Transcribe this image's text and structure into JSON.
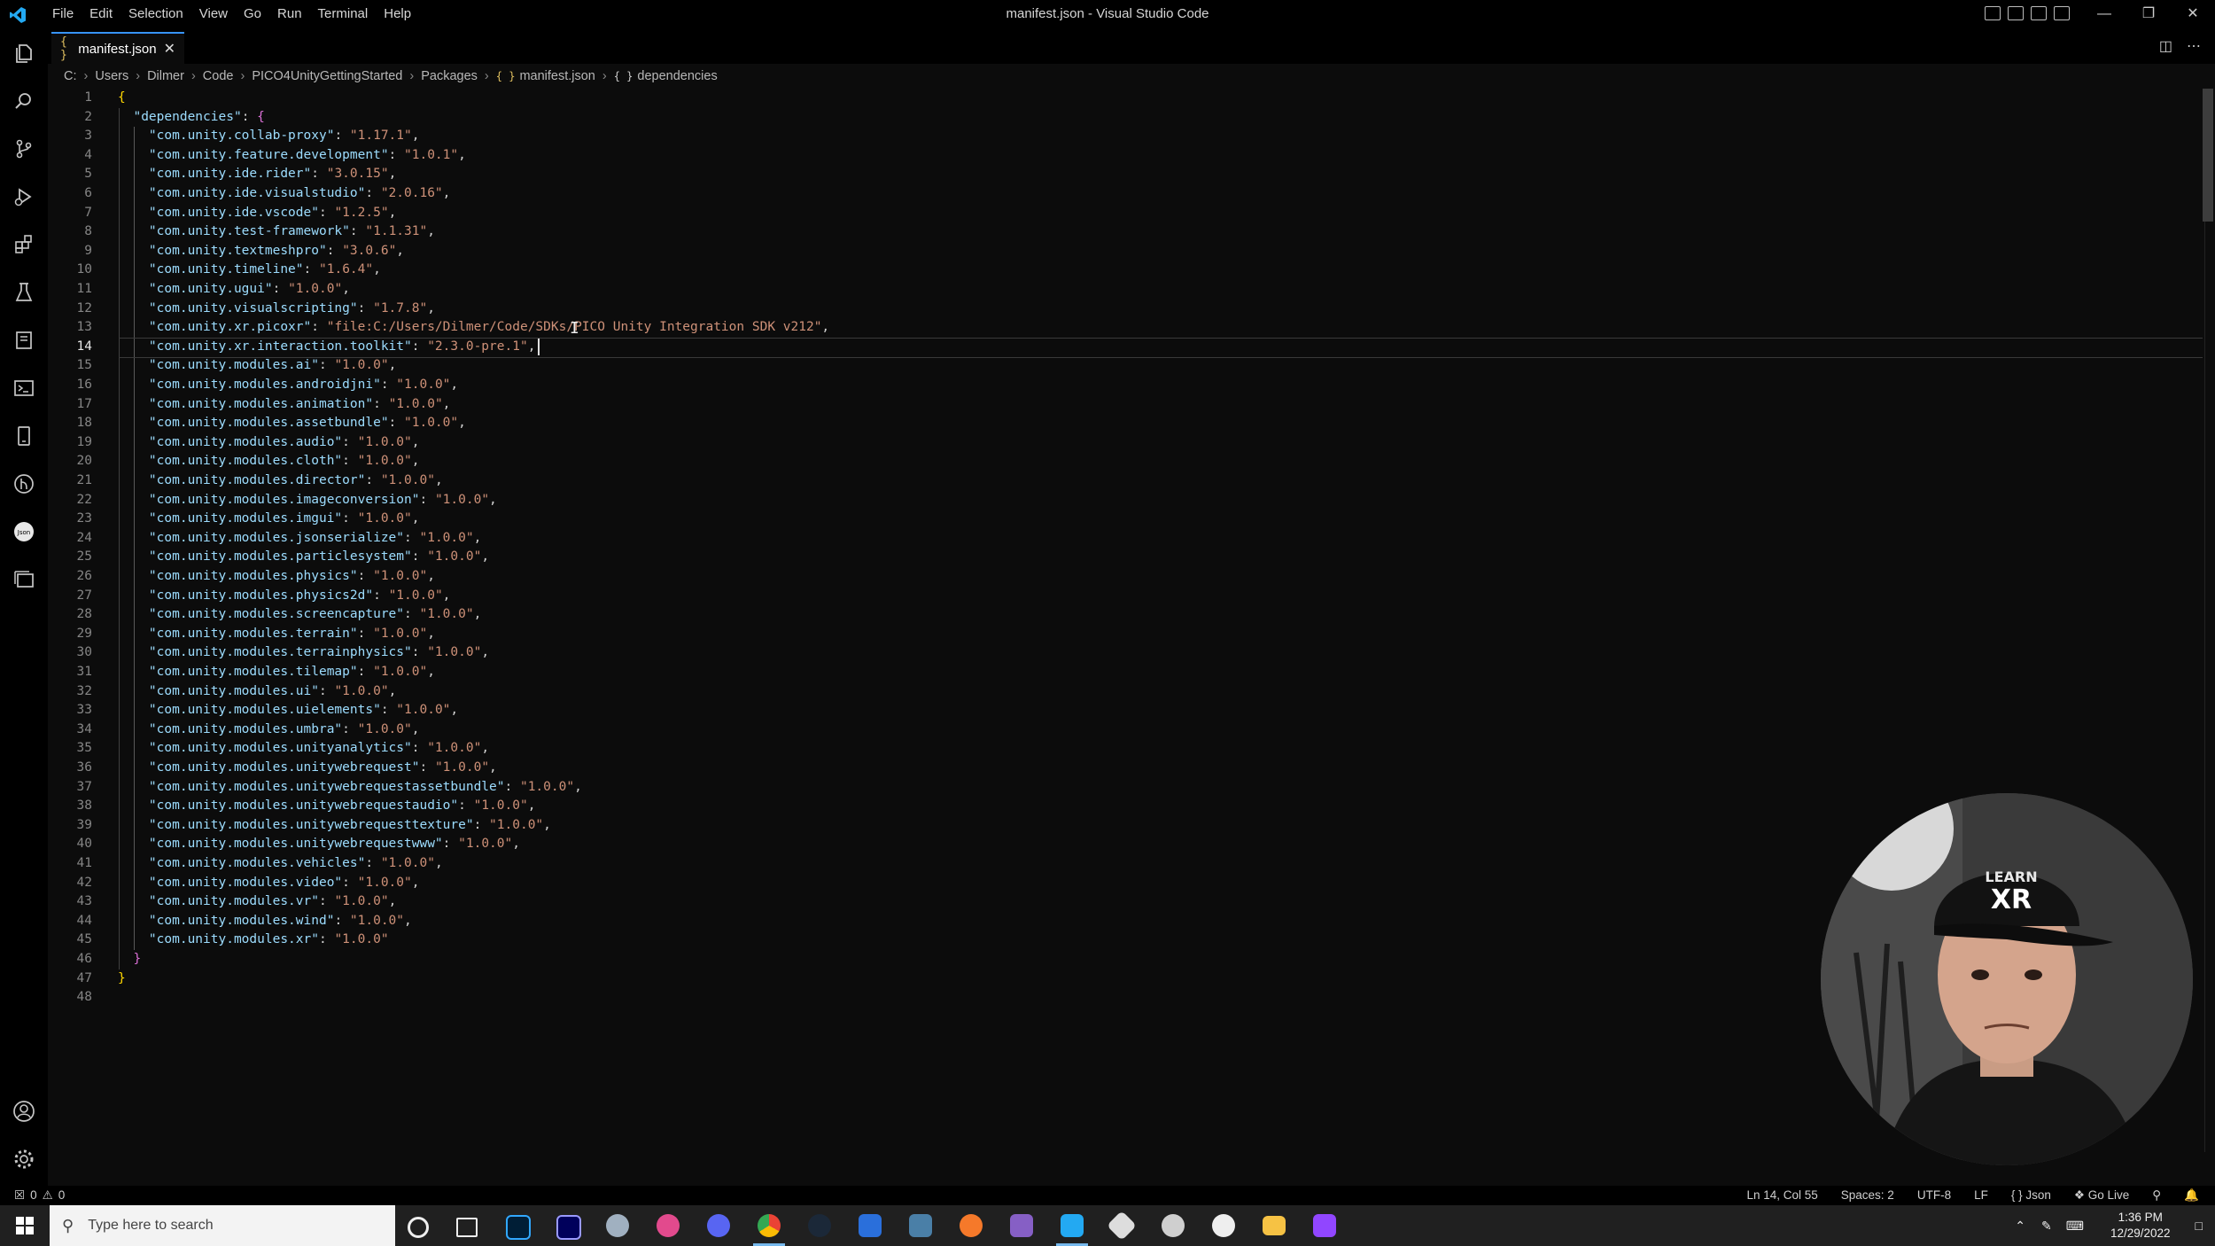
{
  "window": {
    "title": "manifest.json - Visual Studio Code",
    "menu": [
      "File",
      "Edit",
      "Selection",
      "View",
      "Go",
      "Run",
      "Terminal",
      "Help"
    ]
  },
  "tab": {
    "icon": "{ }",
    "label": "manifest.json"
  },
  "breadcrumb": {
    "items": [
      "C:",
      "Users",
      "Dilmer",
      "Code",
      "PICO4UnityGettingStarted",
      "Packages",
      "manifest.json",
      "dependencies"
    ]
  },
  "editor": {
    "current_line": 14,
    "lines": [
      [
        [
          "b1",
          "{"
        ]
      ],
      [
        [
          "p",
          "  "
        ],
        [
          "k",
          "\"dependencies\""
        ],
        [
          "p",
          ": "
        ],
        [
          "b2",
          "{"
        ]
      ],
      [
        [
          "p",
          "    "
        ],
        [
          "k",
          "\"com.unity.collab-proxy\""
        ],
        [
          "p",
          ": "
        ],
        [
          "s",
          "\"1.17.1\""
        ],
        [
          "p",
          ","
        ]
      ],
      [
        [
          "p",
          "    "
        ],
        [
          "k",
          "\"com.unity.feature.development\""
        ],
        [
          "p",
          ": "
        ],
        [
          "s",
          "\"1.0.1\""
        ],
        [
          "p",
          ","
        ]
      ],
      [
        [
          "p",
          "    "
        ],
        [
          "k",
          "\"com.unity.ide.rider\""
        ],
        [
          "p",
          ": "
        ],
        [
          "s",
          "\"3.0.15\""
        ],
        [
          "p",
          ","
        ]
      ],
      [
        [
          "p",
          "    "
        ],
        [
          "k",
          "\"com.unity.ide.visualstudio\""
        ],
        [
          "p",
          ": "
        ],
        [
          "s",
          "\"2.0.16\""
        ],
        [
          "p",
          ","
        ]
      ],
      [
        [
          "p",
          "    "
        ],
        [
          "k",
          "\"com.unity.ide.vscode\""
        ],
        [
          "p",
          ": "
        ],
        [
          "s",
          "\"1.2.5\""
        ],
        [
          "p",
          ","
        ]
      ],
      [
        [
          "p",
          "    "
        ],
        [
          "k",
          "\"com.unity.test-framework\""
        ],
        [
          "p",
          ": "
        ],
        [
          "s",
          "\"1.1.31\""
        ],
        [
          "p",
          ","
        ]
      ],
      [
        [
          "p",
          "    "
        ],
        [
          "k",
          "\"com.unity.textmeshpro\""
        ],
        [
          "p",
          ": "
        ],
        [
          "s",
          "\"3.0.6\""
        ],
        [
          "p",
          ","
        ]
      ],
      [
        [
          "p",
          "    "
        ],
        [
          "k",
          "\"com.unity.timeline\""
        ],
        [
          "p",
          ": "
        ],
        [
          "s",
          "\"1.6.4\""
        ],
        [
          "p",
          ","
        ]
      ],
      [
        [
          "p",
          "    "
        ],
        [
          "k",
          "\"com.unity.ugui\""
        ],
        [
          "p",
          ": "
        ],
        [
          "s",
          "\"1.0.0\""
        ],
        [
          "p",
          ","
        ]
      ],
      [
        [
          "p",
          "    "
        ],
        [
          "k",
          "\"com.unity.visualscripting\""
        ],
        [
          "p",
          ": "
        ],
        [
          "s",
          "\"1.7.8\""
        ],
        [
          "p",
          ","
        ]
      ],
      [
        [
          "p",
          "    "
        ],
        [
          "k",
          "\"com.unity.xr.picoxr\""
        ],
        [
          "p",
          ": "
        ],
        [
          "s",
          "\"file:C:/Users/Dilmer/Code/SDKs/PICO Unity Integration SDK v212\""
        ],
        [
          "p",
          ","
        ]
      ],
      [
        [
          "p",
          "    "
        ],
        [
          "k",
          "\"com.unity.xr.interaction.toolkit\""
        ],
        [
          "p",
          ": "
        ],
        [
          "s",
          "\"2.3.0-pre.1\""
        ],
        [
          "p",
          ","
        ]
      ],
      [
        [
          "p",
          "    "
        ],
        [
          "k",
          "\"com.unity.modules.ai\""
        ],
        [
          "p",
          ": "
        ],
        [
          "s",
          "\"1.0.0\""
        ],
        [
          "p",
          ","
        ]
      ],
      [
        [
          "p",
          "    "
        ],
        [
          "k",
          "\"com.unity.modules.androidjni\""
        ],
        [
          "p",
          ": "
        ],
        [
          "s",
          "\"1.0.0\""
        ],
        [
          "p",
          ","
        ]
      ],
      [
        [
          "p",
          "    "
        ],
        [
          "k",
          "\"com.unity.modules.animation\""
        ],
        [
          "p",
          ": "
        ],
        [
          "s",
          "\"1.0.0\""
        ],
        [
          "p",
          ","
        ]
      ],
      [
        [
          "p",
          "    "
        ],
        [
          "k",
          "\"com.unity.modules.assetbundle\""
        ],
        [
          "p",
          ": "
        ],
        [
          "s",
          "\"1.0.0\""
        ],
        [
          "p",
          ","
        ]
      ],
      [
        [
          "p",
          "    "
        ],
        [
          "k",
          "\"com.unity.modules.audio\""
        ],
        [
          "p",
          ": "
        ],
        [
          "s",
          "\"1.0.0\""
        ],
        [
          "p",
          ","
        ]
      ],
      [
        [
          "p",
          "    "
        ],
        [
          "k",
          "\"com.unity.modules.cloth\""
        ],
        [
          "p",
          ": "
        ],
        [
          "s",
          "\"1.0.0\""
        ],
        [
          "p",
          ","
        ]
      ],
      [
        [
          "p",
          "    "
        ],
        [
          "k",
          "\"com.unity.modules.director\""
        ],
        [
          "p",
          ": "
        ],
        [
          "s",
          "\"1.0.0\""
        ],
        [
          "p",
          ","
        ]
      ],
      [
        [
          "p",
          "    "
        ],
        [
          "k",
          "\"com.unity.modules.imageconversion\""
        ],
        [
          "p",
          ": "
        ],
        [
          "s",
          "\"1.0.0\""
        ],
        [
          "p",
          ","
        ]
      ],
      [
        [
          "p",
          "    "
        ],
        [
          "k",
          "\"com.unity.modules.imgui\""
        ],
        [
          "p",
          ": "
        ],
        [
          "s",
          "\"1.0.0\""
        ],
        [
          "p",
          ","
        ]
      ],
      [
        [
          "p",
          "    "
        ],
        [
          "k",
          "\"com.unity.modules.jsonserialize\""
        ],
        [
          "p",
          ": "
        ],
        [
          "s",
          "\"1.0.0\""
        ],
        [
          "p",
          ","
        ]
      ],
      [
        [
          "p",
          "    "
        ],
        [
          "k",
          "\"com.unity.modules.particlesystem\""
        ],
        [
          "p",
          ": "
        ],
        [
          "s",
          "\"1.0.0\""
        ],
        [
          "p",
          ","
        ]
      ],
      [
        [
          "p",
          "    "
        ],
        [
          "k",
          "\"com.unity.modules.physics\""
        ],
        [
          "p",
          ": "
        ],
        [
          "s",
          "\"1.0.0\""
        ],
        [
          "p",
          ","
        ]
      ],
      [
        [
          "p",
          "    "
        ],
        [
          "k",
          "\"com.unity.modules.physics2d\""
        ],
        [
          "p",
          ": "
        ],
        [
          "s",
          "\"1.0.0\""
        ],
        [
          "p",
          ","
        ]
      ],
      [
        [
          "p",
          "    "
        ],
        [
          "k",
          "\"com.unity.modules.screencapture\""
        ],
        [
          "p",
          ": "
        ],
        [
          "s",
          "\"1.0.0\""
        ],
        [
          "p",
          ","
        ]
      ],
      [
        [
          "p",
          "    "
        ],
        [
          "k",
          "\"com.unity.modules.terrain\""
        ],
        [
          "p",
          ": "
        ],
        [
          "s",
          "\"1.0.0\""
        ],
        [
          "p",
          ","
        ]
      ],
      [
        [
          "p",
          "    "
        ],
        [
          "k",
          "\"com.unity.modules.terrainphysics\""
        ],
        [
          "p",
          ": "
        ],
        [
          "s",
          "\"1.0.0\""
        ],
        [
          "p",
          ","
        ]
      ],
      [
        [
          "p",
          "    "
        ],
        [
          "k",
          "\"com.unity.modules.tilemap\""
        ],
        [
          "p",
          ": "
        ],
        [
          "s",
          "\"1.0.0\""
        ],
        [
          "p",
          ","
        ]
      ],
      [
        [
          "p",
          "    "
        ],
        [
          "k",
          "\"com.unity.modules.ui\""
        ],
        [
          "p",
          ": "
        ],
        [
          "s",
          "\"1.0.0\""
        ],
        [
          "p",
          ","
        ]
      ],
      [
        [
          "p",
          "    "
        ],
        [
          "k",
          "\"com.unity.modules.uielements\""
        ],
        [
          "p",
          ": "
        ],
        [
          "s",
          "\"1.0.0\""
        ],
        [
          "p",
          ","
        ]
      ],
      [
        [
          "p",
          "    "
        ],
        [
          "k",
          "\"com.unity.modules.umbra\""
        ],
        [
          "p",
          ": "
        ],
        [
          "s",
          "\"1.0.0\""
        ],
        [
          "p",
          ","
        ]
      ],
      [
        [
          "p",
          "    "
        ],
        [
          "k",
          "\"com.unity.modules.unityanalytics\""
        ],
        [
          "p",
          ": "
        ],
        [
          "s",
          "\"1.0.0\""
        ],
        [
          "p",
          ","
        ]
      ],
      [
        [
          "p",
          "    "
        ],
        [
          "k",
          "\"com.unity.modules.unitywebrequest\""
        ],
        [
          "p",
          ": "
        ],
        [
          "s",
          "\"1.0.0\""
        ],
        [
          "p",
          ","
        ]
      ],
      [
        [
          "p",
          "    "
        ],
        [
          "k",
          "\"com.unity.modules.unitywebrequestassetbundle\""
        ],
        [
          "p",
          ": "
        ],
        [
          "s",
          "\"1.0.0\""
        ],
        [
          "p",
          ","
        ]
      ],
      [
        [
          "p",
          "    "
        ],
        [
          "k",
          "\"com.unity.modules.unitywebrequestaudio\""
        ],
        [
          "p",
          ": "
        ],
        [
          "s",
          "\"1.0.0\""
        ],
        [
          "p",
          ","
        ]
      ],
      [
        [
          "p",
          "    "
        ],
        [
          "k",
          "\"com.unity.modules.unitywebrequesttexture\""
        ],
        [
          "p",
          ": "
        ],
        [
          "s",
          "\"1.0.0\""
        ],
        [
          "p",
          ","
        ]
      ],
      [
        [
          "p",
          "    "
        ],
        [
          "k",
          "\"com.unity.modules.unitywebrequestwww\""
        ],
        [
          "p",
          ": "
        ],
        [
          "s",
          "\"1.0.0\""
        ],
        [
          "p",
          ","
        ]
      ],
      [
        [
          "p",
          "    "
        ],
        [
          "k",
          "\"com.unity.modules.vehicles\""
        ],
        [
          "p",
          ": "
        ],
        [
          "s",
          "\"1.0.0\""
        ],
        [
          "p",
          ","
        ]
      ],
      [
        [
          "p",
          "    "
        ],
        [
          "k",
          "\"com.unity.modules.video\""
        ],
        [
          "p",
          ": "
        ],
        [
          "s",
          "\"1.0.0\""
        ],
        [
          "p",
          ","
        ]
      ],
      [
        [
          "p",
          "    "
        ],
        [
          "k",
          "\"com.unity.modules.vr\""
        ],
        [
          "p",
          ": "
        ],
        [
          "s",
          "\"1.0.0\""
        ],
        [
          "p",
          ","
        ]
      ],
      [
        [
          "p",
          "    "
        ],
        [
          "k",
          "\"com.unity.modules.wind\""
        ],
        [
          "p",
          ": "
        ],
        [
          "s",
          "\"1.0.0\""
        ],
        [
          "p",
          ","
        ]
      ],
      [
        [
          "p",
          "    "
        ],
        [
          "k",
          "\"com.unity.modules.xr\""
        ],
        [
          "p",
          ": "
        ],
        [
          "s",
          "\"1.0.0\""
        ]
      ],
      [
        [
          "p",
          "  "
        ],
        [
          "b2",
          "}"
        ]
      ],
      [
        [
          "b1",
          "}"
        ]
      ],
      []
    ]
  },
  "statusbar": {
    "errors": "0",
    "warnings": "0",
    "position": "Ln 14, Col 55",
    "spaces": "Spaces: 2",
    "encoding": "UTF-8",
    "eol": "LF",
    "language": "Json",
    "golive": "Go Live"
  },
  "taskbar": {
    "search_placeholder": "Type here to search",
    "time": "1:36 PM",
    "date": "12/29/2022"
  },
  "colors": {
    "accent": "#3794ff",
    "key": "#9cdcfe",
    "string": "#ce9178",
    "bracket1": "#ffd700",
    "bracket2": "#da70d6"
  },
  "icons": {
    "activity": [
      "explorer-icon",
      "search-icon",
      "source-control-icon",
      "run-debug-icon",
      "extensions-icon",
      "testing-icon",
      "remote-explorer-icon",
      "terminal-icon",
      "device-icon",
      "gitlens-icon",
      "json-icon",
      "window-icon"
    ],
    "activity_bottom": [
      "account-icon",
      "settings-gear-icon"
    ]
  }
}
